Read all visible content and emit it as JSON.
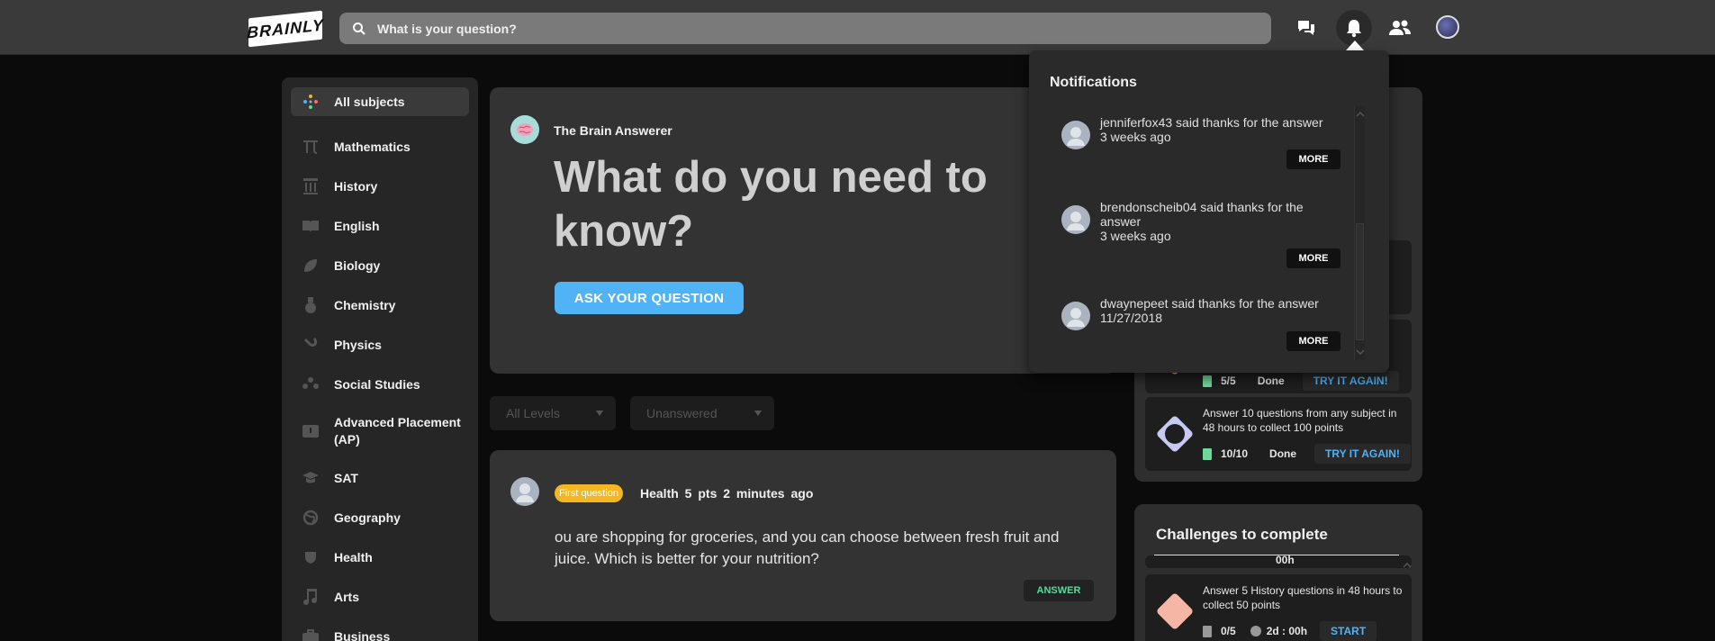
{
  "topbar": {
    "logo": "BRAINLY",
    "search_placeholder": "What is your question?"
  },
  "sidebar": {
    "items": [
      {
        "label": "All subjects",
        "icon": "all-subjects-icon"
      },
      {
        "label": "Mathematics",
        "icon": "pi-icon"
      },
      {
        "label": "History",
        "icon": "column-icon"
      },
      {
        "label": "English",
        "icon": "book-icon"
      },
      {
        "label": "Biology",
        "icon": "leaf-icon"
      },
      {
        "label": "Chemistry",
        "icon": "flask-icon"
      },
      {
        "label": "Physics",
        "icon": "magnet-icon"
      },
      {
        "label": "Social Studies",
        "icon": "people-icon"
      },
      {
        "label": "Advanced Placement (AP)",
        "icon": "ap-icon"
      },
      {
        "label": "SAT",
        "icon": "grad-cap-icon"
      },
      {
        "label": "Geography",
        "icon": "globe-icon"
      },
      {
        "label": "Health",
        "icon": "heart-icon"
      },
      {
        "label": "Arts",
        "icon": "music-note-icon"
      },
      {
        "label": "Business",
        "icon": "briefcase-icon"
      }
    ]
  },
  "hero": {
    "user_name": "The Brain  Answerer",
    "headline": "What do you need to know?",
    "ask_button": "ASK YOUR QUESTION"
  },
  "filters": {
    "levels": "All Levels",
    "status": "Unanswered"
  },
  "question": {
    "badge": "First question",
    "meta": "Health  5 pts  2 minutes ago",
    "text": "ou are shopping for groceries, and you can choose between fresh fruit and juice. Which is better for your nutrition?",
    "answer_button": "ANSWER"
  },
  "challenges_done": {
    "partial_progress": "5/5",
    "partial_status": "Done",
    "partial_button": "TRY IT AGAIN!",
    "item": {
      "text": "Answer 10 questions from any subject in 48 hours to collect 100 points",
      "progress": "10/10",
      "status": "Done",
      "button": "TRY IT AGAIN!"
    }
  },
  "challenges_todo": {
    "title": "Challenges to complete",
    "partial_time": "00h",
    "item": {
      "text": "Answer 5 History questions in 48 hours to collect 50 points",
      "progress": "0/5",
      "time": "2d : 00h",
      "button": "START"
    }
  },
  "notifications": {
    "title": "Notifications",
    "items": [
      {
        "text": "jenniferfox43 said thanks for the answer",
        "time": "3 weeks ago",
        "button": "MORE"
      },
      {
        "text": "brendonscheib04 said thanks for the answer",
        "time": "3 weeks ago",
        "button": "MORE"
      },
      {
        "text": "dwaynepeet said thanks for the answer",
        "time": "11/27/2018",
        "button": "MORE"
      }
    ]
  },
  "colors": {
    "accent": "#4fb3f6",
    "badge": "#f5b623",
    "answer": "#5cd99b"
  }
}
